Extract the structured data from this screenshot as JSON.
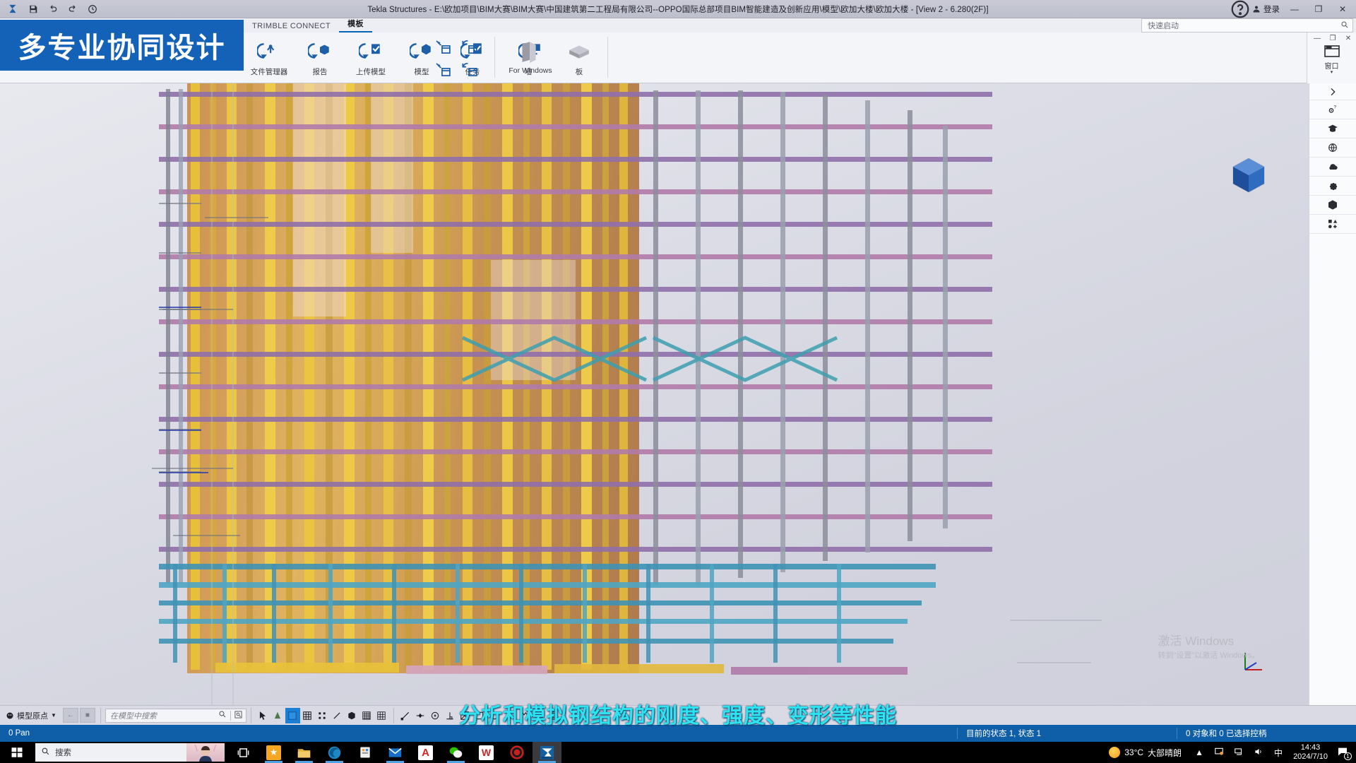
{
  "titlebar": {
    "title": "Tekla Structures - E:\\欧加项目\\BIM大赛\\BIM大赛\\中国建筑第二工程局有限公司--OPPO国际总部项目BIM智能建造及创新应用\\模型\\欧加大楼\\欧加大楼  -  [View 2 - 6.280(2F)]",
    "quick_access": [
      "save-icon",
      "undo-icon",
      "redo-icon",
      "history-icon"
    ],
    "help_label": "?",
    "login_label": "登录",
    "minimize": "—",
    "maximize": "❐",
    "close": "✕"
  },
  "tabs": [
    {
      "label": "TRIMBLE CONNECT",
      "active": false
    },
    {
      "label": "模板",
      "active": true
    }
  ],
  "quick_launch": {
    "placeholder": "快速启动",
    "icon": "search-icon"
  },
  "banner": {
    "text": "多专业协同设计",
    "color": "#1362b8"
  },
  "ribbon": {
    "items": [
      {
        "label": "文件管理器",
        "icon": "folder-manager-icon"
      },
      {
        "label": "报告",
        "icon": "report-icon"
      },
      {
        "label": "上传模型",
        "icon": "upload-model-icon"
      },
      {
        "label": "模型",
        "icon": "model-cube-icon"
      },
      {
        "label": "任务",
        "icon": "task-check-icon"
      },
      {
        "label": "For Windows",
        "icon": "desktop-sync-icon"
      }
    ],
    "small_items": [
      {
        "icon": "open-view-icon"
      },
      {
        "icon": "refresh-view-icon"
      },
      {
        "icon": "open-view2-icon"
      },
      {
        "icon": "refresh-view2-icon"
      }
    ],
    "extra_items": [
      {
        "label": "墙",
        "icon": "wall-icon"
      },
      {
        "label": "板",
        "icon": "slab-icon"
      }
    ]
  },
  "sub_window": {
    "label": "窗口",
    "minimize": "—",
    "restore": "❐",
    "close": "✕"
  },
  "right_rail": {
    "items": [
      {
        "icon": "chevron-right-icon",
        "name": "collapse-rail"
      },
      {
        "icon": "help-gear-icon",
        "name": "help-settings"
      },
      {
        "icon": "graduation-cap-icon",
        "name": "learning"
      },
      {
        "icon": "globe-icon",
        "name": "globe"
      },
      {
        "icon": "cloud-icon",
        "name": "cloud"
      },
      {
        "icon": "gear-icon",
        "name": "settings"
      },
      {
        "icon": "cube-icon",
        "name": "components"
      },
      {
        "icon": "apps-grid-icon",
        "name": "applications"
      }
    ]
  },
  "viewport": {
    "watermark_line1": "激活 Windows",
    "watermark_line2": "转到\"设置\"以激活 Windows。",
    "navcube": "view-cube-icon"
  },
  "bottom_toolbar": {
    "origin_selector": "模型原点",
    "search_placeholder": "在模型中搜索",
    "search_icon": "search-icon",
    "search_adv_icon": "advanced-search-icon",
    "tools": [
      {
        "icon": "cursor-arrow-icon",
        "selected": false
      },
      {
        "icon": "select-component-icon",
        "selected": false
      },
      {
        "icon": "select-object-icon",
        "selected": true
      },
      {
        "icon": "select-assembly-icon",
        "selected": false
      },
      {
        "icon": "select-points-icon",
        "selected": false
      },
      {
        "icon": "select-line-icon",
        "selected": false
      },
      {
        "icon": "select-part-icon",
        "selected": false
      },
      {
        "icon": "select-grid-icon",
        "selected": false
      },
      {
        "icon": "select-mesh-icon",
        "selected": false
      },
      {
        "icon": "snap-end-icon",
        "selected": false
      },
      {
        "icon": "snap-midpoint-icon",
        "selected": false
      },
      {
        "icon": "snap-center-icon",
        "selected": false
      },
      {
        "icon": "snap-perp-icon",
        "selected": false
      },
      {
        "icon": "snap-nearest-icon",
        "selected": false
      },
      {
        "icon": "snap-intersect-icon",
        "selected": false
      },
      {
        "icon": "snap-box-icon",
        "selected": false
      },
      {
        "icon": "snap-circle-icon",
        "selected": false
      },
      {
        "icon": "snap-any-icon",
        "selected": false
      },
      {
        "icon": "snap-free-icon",
        "selected": false
      },
      {
        "icon": "ortho-icon",
        "selected": false
      },
      {
        "icon": "hourglass-icon",
        "selected": false
      }
    ]
  },
  "status_bar": {
    "pan": "0 Pan",
    "state": "目前的状态 1, 状态 1",
    "selection": "0 对象和 0 已选择控柄"
  },
  "subtitle": {
    "text": "分析和模拟钢结构的刚度、强度、变形等性能",
    "color": "#2ce4ef"
  },
  "taskbar": {
    "start_icon": "windows-start-icon",
    "search_placeholder": "搜索",
    "search_icon": "search-icon",
    "apps": [
      {
        "name": "task-view",
        "icon": "task-view-icon",
        "label": "",
        "color": "#1f1f22"
      },
      {
        "name": "app-star",
        "icon": "star-icon",
        "label": "",
        "color": "#f5a623"
      },
      {
        "name": "file-explorer",
        "icon": "folder-icon",
        "label": "",
        "color": "#e8b33c"
      },
      {
        "name": "microsoft-edge",
        "icon": "edge-icon",
        "label": "",
        "color": "#1e88c7"
      },
      {
        "name": "store",
        "icon": "store-icon",
        "label": "",
        "color": "#f0f0f0"
      },
      {
        "name": "mail",
        "icon": "mail-icon",
        "label": "",
        "color": "#1670c9"
      },
      {
        "name": "autocad",
        "icon": "autocad-icon",
        "label": "A",
        "color": "#d62222"
      },
      {
        "name": "wechat",
        "icon": "wechat-icon",
        "label": "",
        "color": "#2dc100"
      },
      {
        "name": "wps-word",
        "icon": "word-icon",
        "label": "W",
        "color": "#c32b2b"
      },
      {
        "name": "recorder",
        "icon": "record-icon",
        "label": "",
        "color": "#cc2020"
      },
      {
        "name": "tekla-structures",
        "icon": "tekla-icon",
        "label": "",
        "color": "#1362b8"
      }
    ],
    "weather": {
      "temp": "33°C",
      "desc": "大部晴朗",
      "icon": "sun-cloud-icon"
    },
    "tray": [
      {
        "icon": "chevron-up-icon",
        "name": "show-hidden-icons"
      },
      {
        "icon": "monitor-share-icon",
        "name": "display-share"
      },
      {
        "icon": "network-icon",
        "name": "network"
      },
      {
        "icon": "volume-icon",
        "name": "volume"
      },
      {
        "icon": "ime-icon",
        "name": "input-method",
        "label": "中"
      }
    ],
    "clock": {
      "time": "14:43",
      "date": "2024/7/10"
    },
    "notifications": {
      "icon": "notification-icon",
      "count": "1"
    }
  }
}
